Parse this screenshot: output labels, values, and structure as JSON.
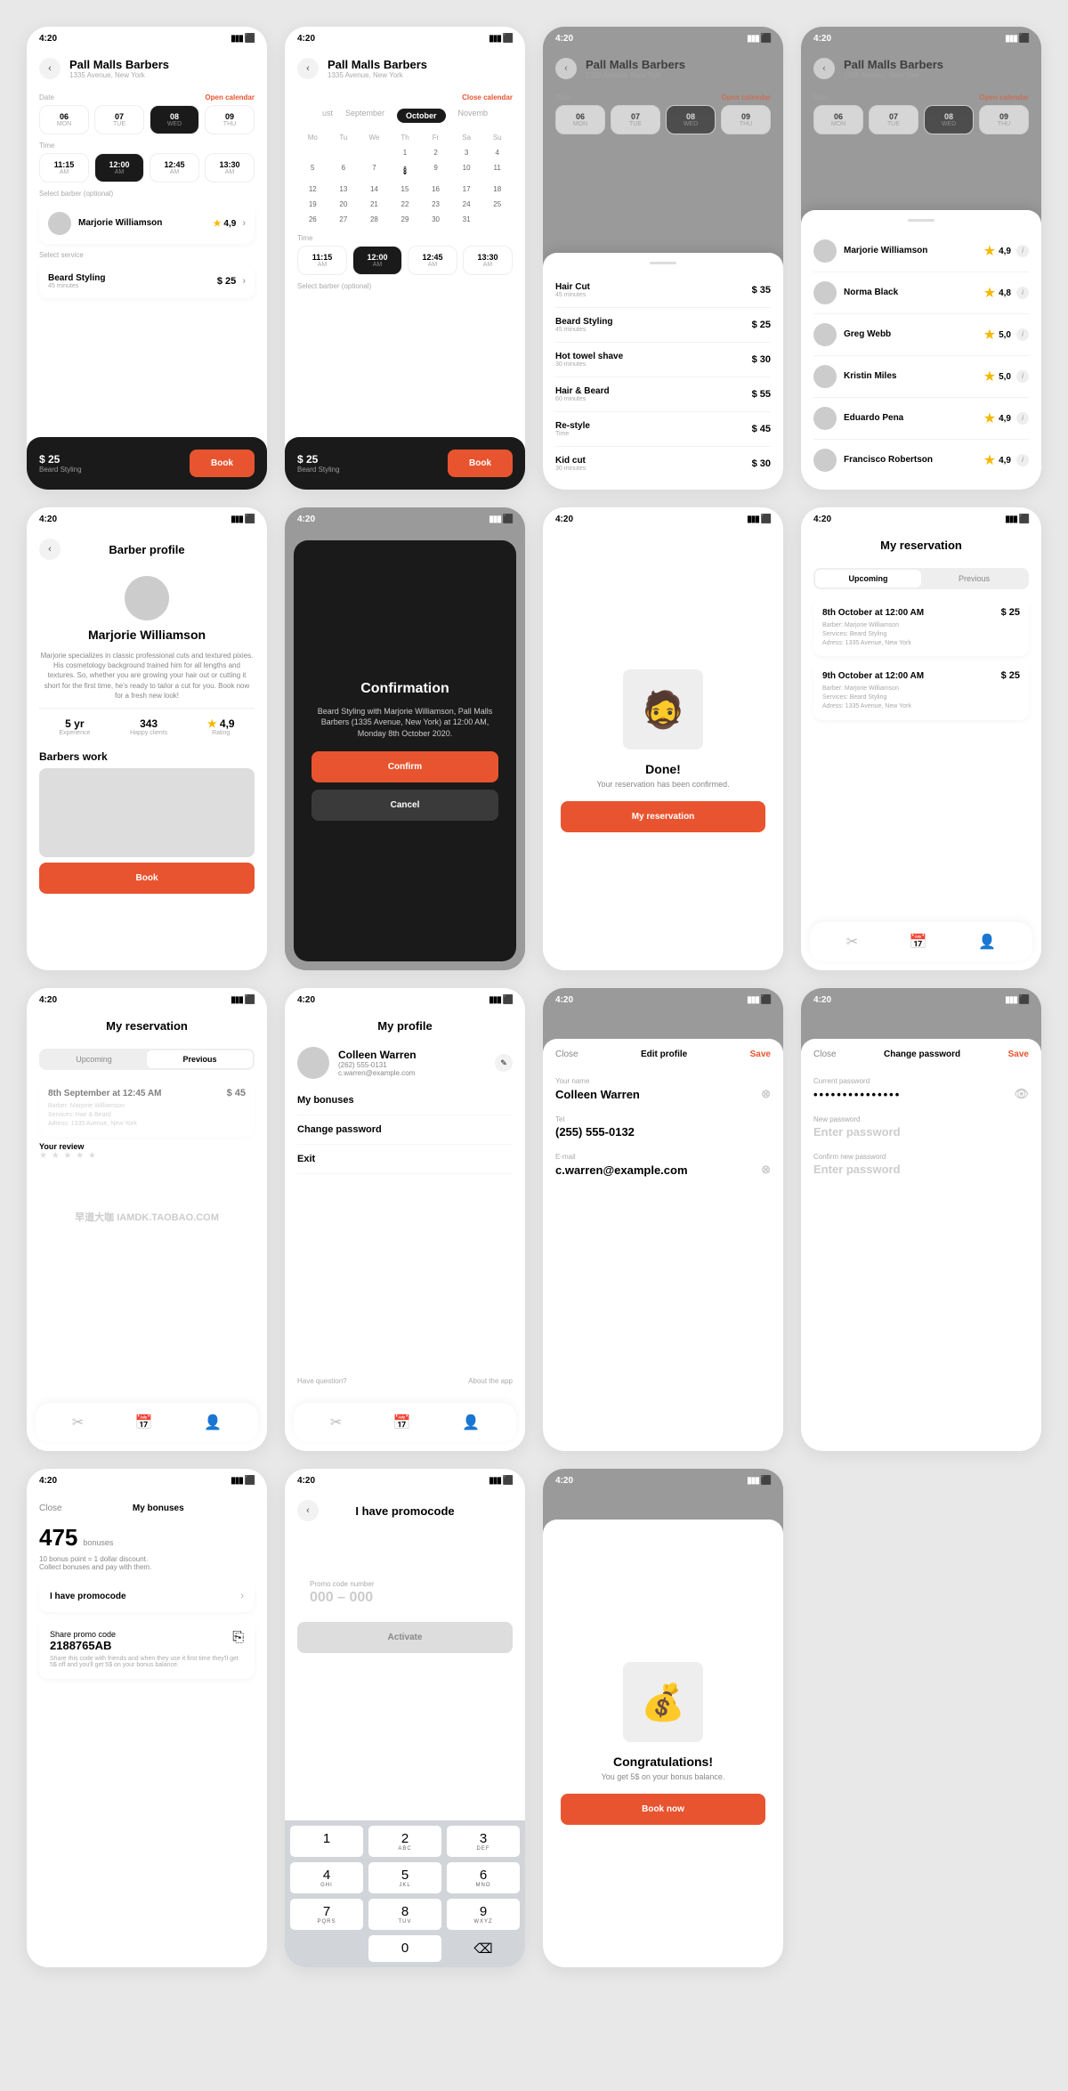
{
  "time": "4:20",
  "shop": {
    "name": "Pall Malls Barbers",
    "addr": "1335 Avenue, New York"
  },
  "labels": {
    "date": "Date",
    "time": "Time",
    "open_cal": "Open calendar",
    "close_cal": "Close calendar",
    "sel_barber": "Select barber (optional)",
    "sel_service": "Select service",
    "book": "Book",
    "confirm": "Confirm",
    "cancel": "Cancel",
    "close": "Close",
    "save": "Save",
    "activate": "Activate"
  },
  "dates": [
    {
      "d": "06",
      "w": "MON"
    },
    {
      "d": "07",
      "w": "TUE"
    },
    {
      "d": "08",
      "w": "WED"
    },
    {
      "d": "09",
      "w": "THU"
    }
  ],
  "times": [
    {
      "t": "11:15",
      "m": "AM"
    },
    {
      "t": "12:00",
      "m": "AM"
    },
    {
      "t": "12:45",
      "m": "AM"
    },
    {
      "t": "13:30",
      "m": "AM"
    }
  ],
  "months": [
    "ust",
    "September",
    "October",
    "Novemb"
  ],
  "dows": [
    "Mo",
    "Tu",
    "We",
    "Th",
    "Fr",
    "Sa",
    "Su"
  ],
  "barber": {
    "name": "Marjorie Williamson",
    "rating": "4,9"
  },
  "service": {
    "name": "Beard Styling",
    "dur": "45 minutes",
    "price": "$ 25"
  },
  "footer": {
    "price": "$ 25",
    "svc": "Beard Styling"
  },
  "services": [
    {
      "n": "Hair Cut",
      "d": "45 minutes",
      "p": "$ 35"
    },
    {
      "n": "Beard Styling",
      "d": "45 minutes",
      "p": "$ 25"
    },
    {
      "n": "Hot towel shave",
      "d": "30 minutes",
      "p": "$ 30"
    },
    {
      "n": "Hair & Beard",
      "d": "60 minutes",
      "p": "$ 55"
    },
    {
      "n": "Re-style",
      "d": "Time",
      "p": "$ 45"
    },
    {
      "n": "Kid cut",
      "d": "30 minutes",
      "p": "$ 30"
    }
  ],
  "barbers": [
    {
      "n": "Marjorie Williamson",
      "r": "4,9"
    },
    {
      "n": "Norma Black",
      "r": "4,8"
    },
    {
      "n": "Greg Webb",
      "r": "5,0"
    },
    {
      "n": "Kristin Miles",
      "r": "5,0"
    },
    {
      "n": "Eduardo Pena",
      "r": "4,9"
    },
    {
      "n": "Francisco Robertson",
      "r": "4,9"
    }
  ],
  "profile": {
    "title": "Barber profile",
    "bio": "Marjorie specializes in classic professional cuts and textured pixies. His cosmetology background trained him for all lengths and textures. So, whether you are growing your hair out or cutting it short for the first time, he's ready to tailor a cut for you. Book now for a fresh new look!",
    "stats": [
      {
        "v": "5 yr",
        "l": "Experience"
      },
      {
        "v": "343",
        "l": "Happy clients"
      },
      {
        "v": "4,9",
        "l": "Rating"
      }
    ],
    "work": "Barbers work"
  },
  "confirm": {
    "title": "Confirmation",
    "text": "Beard Styling with Marjorie Williamson, Pall Malls Barbers (1335 Avenue, New York) at 12:00 AM, Monday 8th October 2020."
  },
  "done": {
    "title": "Done!",
    "text": "Your reservation has been confirmed.",
    "btn": "My reservation"
  },
  "myres": {
    "title": "My reservation",
    "tabs": [
      "Upcoming",
      "Previous"
    ],
    "items": [
      {
        "t": "8th October at 12:00 AM",
        "b": "Barber: Marjorie Williamson",
        "s": "Services: Beard Styling",
        "a": "Adress: 1335 Avenue, New York",
        "p": "$ 25"
      },
      {
        "t": "9th October at 12:00 AM",
        "b": "Barber: Marjorie Williamson",
        "s": "Services: Beard Styling",
        "a": "Adress: 1335 Avenue, New York",
        "p": "$ 25"
      }
    ],
    "prev": {
      "t": "8th September at 12:45 AM",
      "b": "Barber: Marjorie Williamson",
      "s": "Services: Hair & Beard",
      "a": "Adress: 1335 Avenue, New York",
      "p": "$ 45"
    },
    "review": "Your review"
  },
  "myprof": {
    "title": "My profile",
    "name": "Colleen Warren",
    "phone": "(262) 555-0131",
    "email": "c.warren@example.com",
    "menu": [
      "My bonuses",
      "Change password",
      "Exit"
    ],
    "q": "Have question?",
    "about": "About the app"
  },
  "edit": {
    "title": "Edit profile",
    "f1": {
      "l": "Your name",
      "v": "Colleen Warren"
    },
    "f2": {
      "l": "Tel",
      "v": "(255) 555-0132"
    },
    "f3": {
      "l": "E-mail",
      "v": "c.warren@example.com"
    }
  },
  "pwd": {
    "title": "Change password",
    "f1": {
      "l": "Current password",
      "v": "•••••••••••••••"
    },
    "f2": {
      "l": "New password",
      "v": "Enter password"
    },
    "f3": {
      "l": "Confirm new password",
      "v": "Enter password"
    }
  },
  "bonus": {
    "title": "My bonuses",
    "pts": "475",
    "unit": "bonuses",
    "desc": "10 bonus point = 1 dollar discount.\nCollect bonuses and pay with them.",
    "promo": "I have promocode",
    "share": "Share promo code",
    "code": "2188765AB",
    "note": "Share this code with friends and when they use it first time they'll get 5$ off and you'll get 5$ on your bonus balance."
  },
  "promo": {
    "title": "I have promocode",
    "label": "Promo code number",
    "ph": "000 – 000"
  },
  "keypad": [
    {
      "n": "1",
      "l": ""
    },
    {
      "n": "2",
      "l": "ABC"
    },
    {
      "n": "3",
      "l": "DEF"
    },
    {
      "n": "4",
      "l": "GHI"
    },
    {
      "n": "5",
      "l": "JKL"
    },
    {
      "n": "6",
      "l": "MNO"
    },
    {
      "n": "7",
      "l": "PQRS"
    },
    {
      "n": "8",
      "l": "TUV"
    },
    {
      "n": "9",
      "l": "WXYZ"
    },
    {
      "n": "",
      "l": ""
    },
    {
      "n": "0",
      "l": ""
    },
    {
      "n": "⌫",
      "l": ""
    }
  ],
  "congrats": {
    "title": "Congratulations!",
    "text": "You get 5$ on your bonus balance.",
    "btn": "Book now"
  },
  "watermark": "早道大咖   IAMDK.TAOBAO.COM"
}
